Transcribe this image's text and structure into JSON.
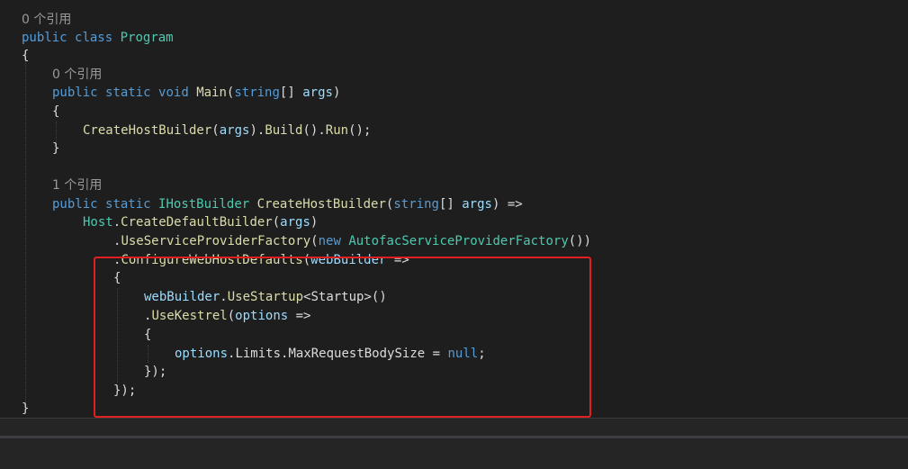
{
  "colors": {
    "background": "#1e1e1e",
    "keyword": "#569cd6",
    "type": "#4ec9b0",
    "method": "#dcdcaa",
    "parameter": "#9cdcfe",
    "plain": "#dcdcdc",
    "codelens": "#999999",
    "highlight_border": "#e02020"
  },
  "code": {
    "refs_class": "0 个引用",
    "refs_main": "0 个引用",
    "refs_create": "1 个引用",
    "kw_public": "public",
    "kw_class": "class",
    "kw_static": "static",
    "kw_void": "void",
    "kw_string": "string",
    "kw_new": "new",
    "kw_null": "null",
    "type_program": "Program",
    "type_ihostbuilder": "IHostBuilder",
    "type_host": "Host",
    "type_autofac": "AutofacServiceProviderFactory",
    "type_startup": "Startup",
    "fn_main": "Main",
    "fn_createhostbuilder": "CreateHostBuilder",
    "fn_build": "Build",
    "fn_run": "Run",
    "fn_createdefaultbuilder": "CreateDefaultBuilder",
    "fn_useserviceproviderfactory": "UseServiceProviderFactory",
    "fn_configurewebhostdefaults": "ConfigureWebHostDefaults",
    "fn_usestartup": "UseStartup",
    "fn_usekestrel": "UseKestrel",
    "param_args": "args",
    "param_webbuilder": "webBuilder",
    "param_options": "options",
    "prop_limits": "Limits",
    "prop_maxrequestbodysize": "MaxRequestBodySize",
    "open_brace": "{",
    "close_brace": "}",
    "open_paren": "(",
    "close_paren": ")",
    "array_suffix": "[] ",
    "dot": ".",
    "call_end": "();",
    "call_empty_end": "())",
    "arrow": " =>",
    "assign": " = ",
    "semicolon": ";",
    "lambda_close": "});",
    "lt": "<",
    "gt": ">()"
  }
}
